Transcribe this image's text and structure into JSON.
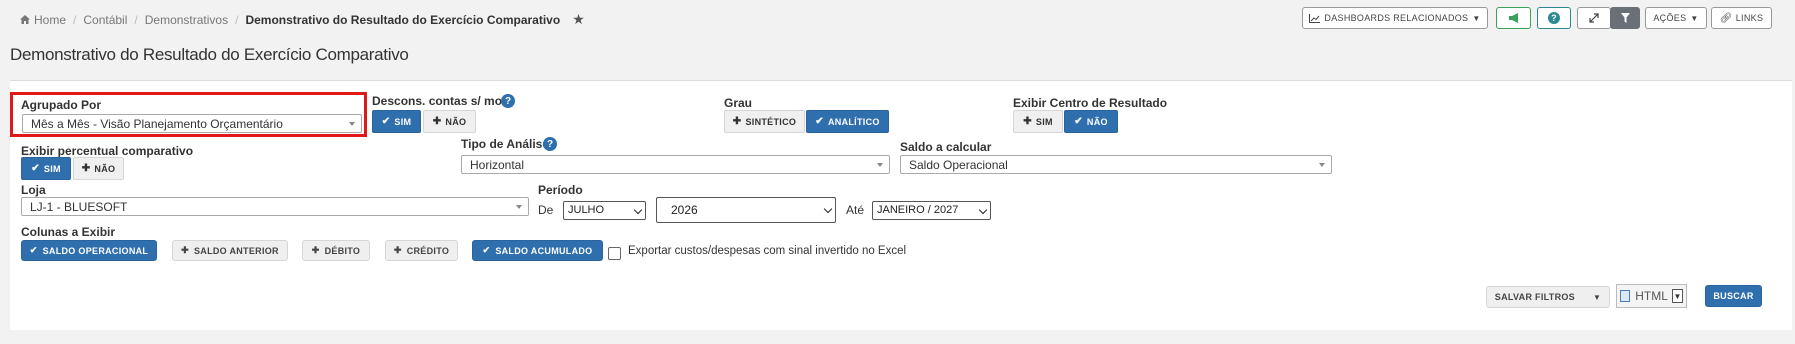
{
  "breadcrumb": {
    "items": [
      "Home",
      "Contábil",
      "Demonstrativos"
    ],
    "current": "Demonstrativo do Resultado do Exercício Comparativo"
  },
  "toolbar": {
    "dashboards": "DASHBOARDS RELACIONADOS",
    "acoes": "AÇÕES",
    "links": "LINKS"
  },
  "page_title": "Demonstrativo do Resultado do Exercício Comparativo",
  "filters": {
    "agrupado_por": {
      "label": "Agrupado Por",
      "value": "Mês a Mês - Visão Planejamento Orçamentário"
    },
    "descons": {
      "label": "Descons. contas s/ mov.",
      "yes": "SIM",
      "no": "NÃO",
      "selected": "yes"
    },
    "grau": {
      "label": "Grau",
      "sintetico": "SINTÉTICO",
      "analitico": "ANALÍTICO",
      "selected": "analitico"
    },
    "centro_resultado": {
      "label": "Exibir Centro de Resultado",
      "yes": "SIM",
      "no": "NÃO",
      "selected": "no"
    },
    "percentual": {
      "label": "Exibir percentual comparativo",
      "yes": "SIM",
      "no": "NÃO",
      "selected": "yes"
    },
    "tipo_analise": {
      "label": "Tipo de Análise",
      "value": "Horizontal"
    },
    "saldo_calcular": {
      "label": "Saldo a calcular",
      "value": "Saldo Operacional"
    },
    "loja": {
      "label": "Loja",
      "value": "LJ-1 - BLUESOFT"
    },
    "periodo": {
      "label": "Período",
      "de_label": "De",
      "mes": "JULHO",
      "ano": "2026",
      "ate_label": "Até",
      "ate_value": "JANEIRO / 2027"
    },
    "colunas": {
      "label": "Colunas a Exibir",
      "saldo_operacional": "SALDO OPERACIONAL",
      "saldo_anterior": "SALDO ANTERIOR",
      "debito": "DÉBITO",
      "credito": "CRÉDITO",
      "saldo_acumulado": "SALDO ACUMULADO"
    },
    "exportar": {
      "label": "Exportar custos/despesas com sinal invertido no Excel",
      "checked": false
    }
  },
  "actions": {
    "salvar_filtros": "SALVAR FILTROS",
    "format": "HTML",
    "buscar": "BUSCAR"
  },
  "colors": {
    "primary": "#2f6fad",
    "highlight": "#e01818",
    "green": "#3aa15a",
    "teal": "#2a8a8f"
  }
}
